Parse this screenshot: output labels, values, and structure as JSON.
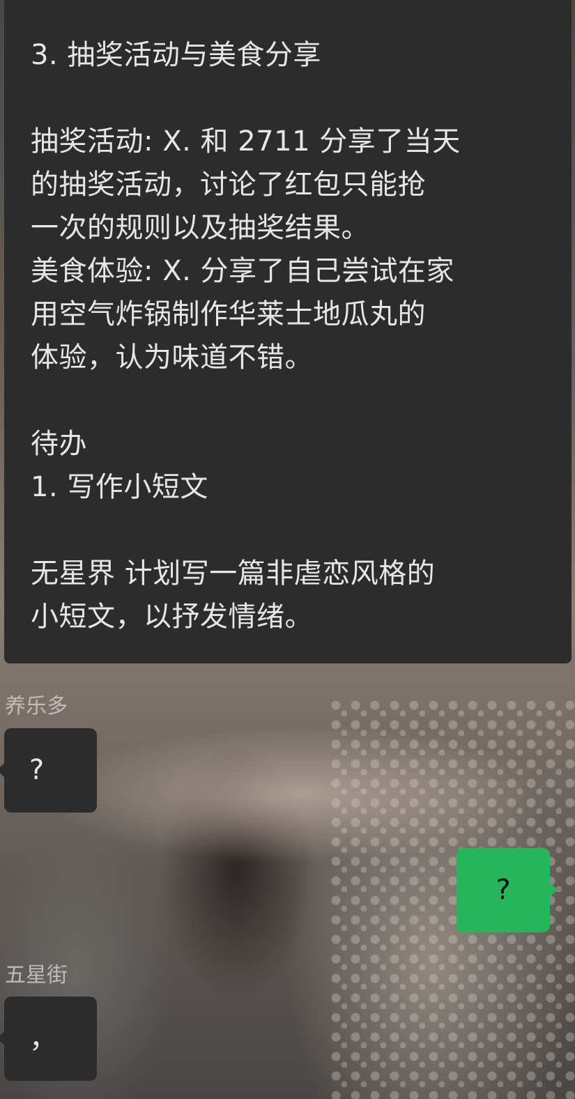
{
  "chat": {
    "summary_message": {
      "lines": [
        "3. 抽奖活动与美食分享",
        "",
        "抽奖活动: X. 和 2711 分享了当天",
        "的抽奖活动，讨论了红包只能抢",
        "一次的规则以及抽奖结果。",
        "美食体验: X. 分享了自己尝试在家",
        "用空气炸锅制作华莱士地瓜丸的",
        "体验，认为味道不错。",
        "",
        "待办",
        "1. 写作小短文",
        "",
        "无星界 计划写一篇非虐恋风格的",
        "小短文，以抒发情绪。"
      ]
    },
    "messages": [
      {
        "sender": "养乐多",
        "text": "?",
        "direction": "incoming"
      },
      {
        "sender": "",
        "text": "?",
        "direction": "outgoing"
      },
      {
        "sender": "五星街",
        "text": "，",
        "direction": "incoming"
      }
    ]
  },
  "colors": {
    "incoming_bubble": "#2c2c2c",
    "outgoing_bubble": "#26b55a",
    "incoming_text": "#e6e6e6",
    "sender_name": "#bdbdbd"
  }
}
